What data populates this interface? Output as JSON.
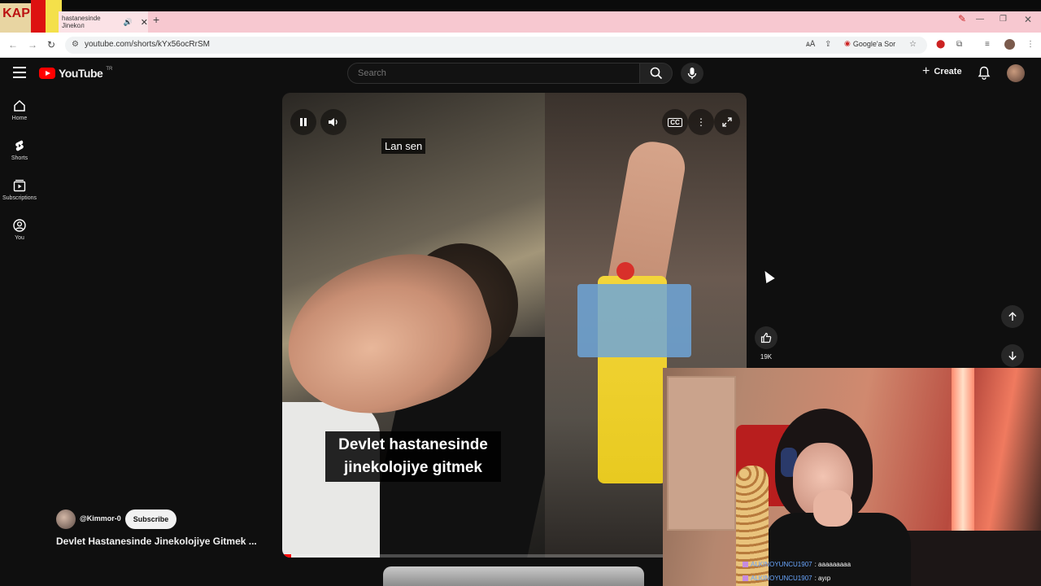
{
  "browser": {
    "tab_title": "hastanesinde Jinekoл",
    "url": "youtube.com/shorts/kYx56ocRrSM",
    "ask_label": "Google'a Sor",
    "kap_logo": "KAP"
  },
  "header": {
    "logo_text": "YouTube",
    "country": "TR",
    "search_placeholder": "Search",
    "create_label": "Create"
  },
  "sidebar": {
    "items": [
      {
        "label": "Home",
        "icon": "home-icon"
      },
      {
        "label": "Shorts",
        "icon": "shorts-icon"
      },
      {
        "label": "Subscriptions",
        "icon": "subscriptions-icon"
      },
      {
        "label": "You",
        "icon": "you-icon"
      }
    ]
  },
  "video": {
    "caption_top": "Lan sen",
    "caption_main": "Devlet hastanesinde jinekolojiye gitmek",
    "progress": 0.02
  },
  "actions": {
    "like_count": "19K"
  },
  "channel": {
    "handle": "@Kimmor-0",
    "subscribe_label": "Subscribe",
    "video_title": "Devlet Hastanesinde Jinekolojiye Gitmek ..."
  },
  "stream_chat": [
    {
      "user": "ALKINOYUNCU1907",
      "message": ": aaaaaaaaa"
    },
    {
      "user": "ALKINOYUNCU1907",
      "message": ": ayıp"
    }
  ]
}
